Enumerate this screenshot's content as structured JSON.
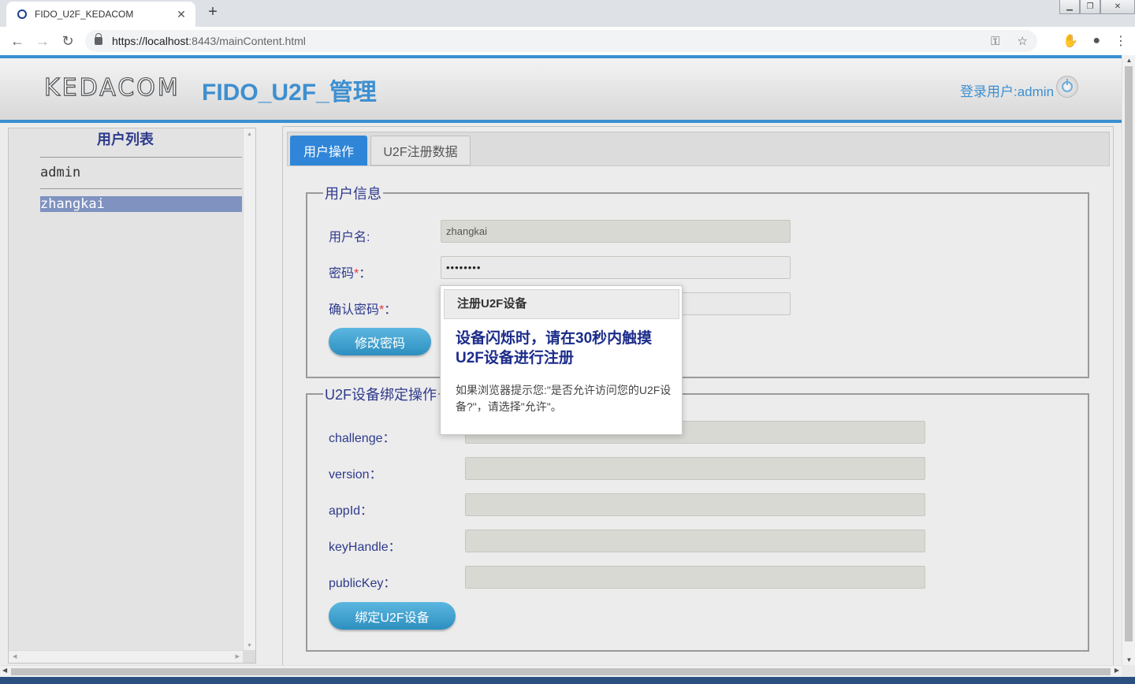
{
  "browser": {
    "tab_title": "FIDO_U2F_KEDACOM",
    "url_scheme_host": "https://localhost",
    "url_rest": ":8443/mainContent.html"
  },
  "header": {
    "logo_text": "KEDACOM",
    "app_title": "FIDO_U2F_管理",
    "login_user": "登录用户:admin"
  },
  "sidebar": {
    "title": "用户列表",
    "users": [
      "admin",
      "zhangkai"
    ],
    "selected_index": 1
  },
  "tabs": [
    {
      "label": "用户操作",
      "active": true
    },
    {
      "label": "U2F注册数据",
      "active": false
    }
  ],
  "user_info": {
    "legend": "用户信息",
    "username_label": "用户名:",
    "username_value": "zhangkai",
    "password_label": "密码",
    "password_value": "••••••••",
    "confirm_label": "确认密码",
    "required_mark": "*",
    "colon": "：",
    "change_button": "修改密码"
  },
  "u2f_bind": {
    "legend": "U2F设备绑定操作",
    "fields": [
      {
        "label": "challenge：",
        "value": ""
      },
      {
        "label": "version：",
        "value": ""
      },
      {
        "label": "appId：",
        "value": ""
      },
      {
        "label": "keyHandle：",
        "value": ""
      },
      {
        "label": "publicKey：",
        "value": ""
      }
    ],
    "bind_button": "绑定U2F设备"
  },
  "modal": {
    "title": "注册U2F设备",
    "main_text": "设备闪烁时，请在30秒内触摸U2F设备进行注册",
    "note": "如果浏览器提示您:\"是否允许访问您的U2F设备?\"，请选择\"允许\"。"
  },
  "colors": {
    "accent": "#3e8fd0",
    "tab_active": "#2f86d8",
    "label": "#2e3a8c",
    "required": "#e23a3a"
  }
}
